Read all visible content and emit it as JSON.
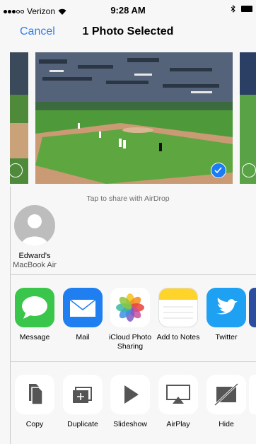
{
  "status_bar": {
    "carrier": "Verizon",
    "time": "9:28 AM"
  },
  "nav": {
    "cancel": "Cancel",
    "title": "1 Photo Selected"
  },
  "airdrop": {
    "hint": "Tap to share with AirDrop",
    "device_line1": "Edward's",
    "device_line2": "MacBook Air"
  },
  "share_apps": [
    {
      "label": "Message"
    },
    {
      "label": "Mail"
    },
    {
      "label": "iCloud Photo Sharing"
    },
    {
      "label": "Add to Notes"
    },
    {
      "label": "Twitter"
    }
  ],
  "actions": [
    {
      "label": "Copy"
    },
    {
      "label": "Duplicate"
    },
    {
      "label": "Slideshow"
    },
    {
      "label": "AirPlay"
    },
    {
      "label": "Hide"
    }
  ],
  "colors": {
    "accent": "#2e7cf6",
    "messages": "#39c64a",
    "mail": "#1f7ff0",
    "twitter": "#1ea1f2",
    "notes": "#ffd42a"
  }
}
